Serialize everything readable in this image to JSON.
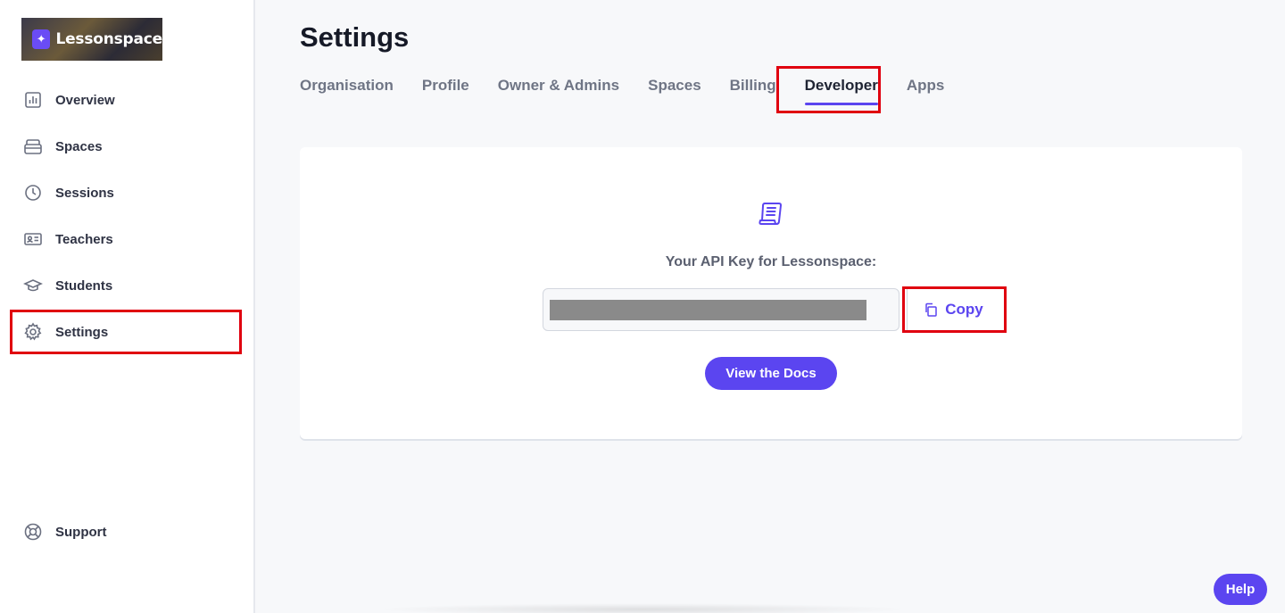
{
  "brand": {
    "name": "Lessonspace",
    "logo_icon": "lessonspace-star-icon"
  },
  "sidebar": {
    "items": [
      {
        "label": "Overview",
        "icon": "chart-icon"
      },
      {
        "label": "Spaces",
        "icon": "layers-icon"
      },
      {
        "label": "Sessions",
        "icon": "clock-icon"
      },
      {
        "label": "Teachers",
        "icon": "id-card-icon"
      },
      {
        "label": "Students",
        "icon": "graduation-cap-icon"
      },
      {
        "label": "Settings",
        "icon": "gear-icon",
        "active": true
      }
    ],
    "support": {
      "label": "Support",
      "icon": "lifebuoy-icon"
    }
  },
  "page": {
    "title": "Settings"
  },
  "tabs": [
    {
      "label": "Organisation"
    },
    {
      "label": "Profile"
    },
    {
      "label": "Owner & Admins"
    },
    {
      "label": "Spaces"
    },
    {
      "label": "Billing"
    },
    {
      "label": "Developer",
      "active": true
    },
    {
      "label": "Apps"
    }
  ],
  "developer": {
    "api_label": "Your API Key for Lessonspace:",
    "copy_label": "Copy",
    "docs_label": "View the Docs"
  },
  "help": {
    "label": "Help"
  },
  "colors": {
    "accent": "#5b45f0",
    "highlight_box": "#e0000f",
    "background": "#f7f8fa"
  }
}
